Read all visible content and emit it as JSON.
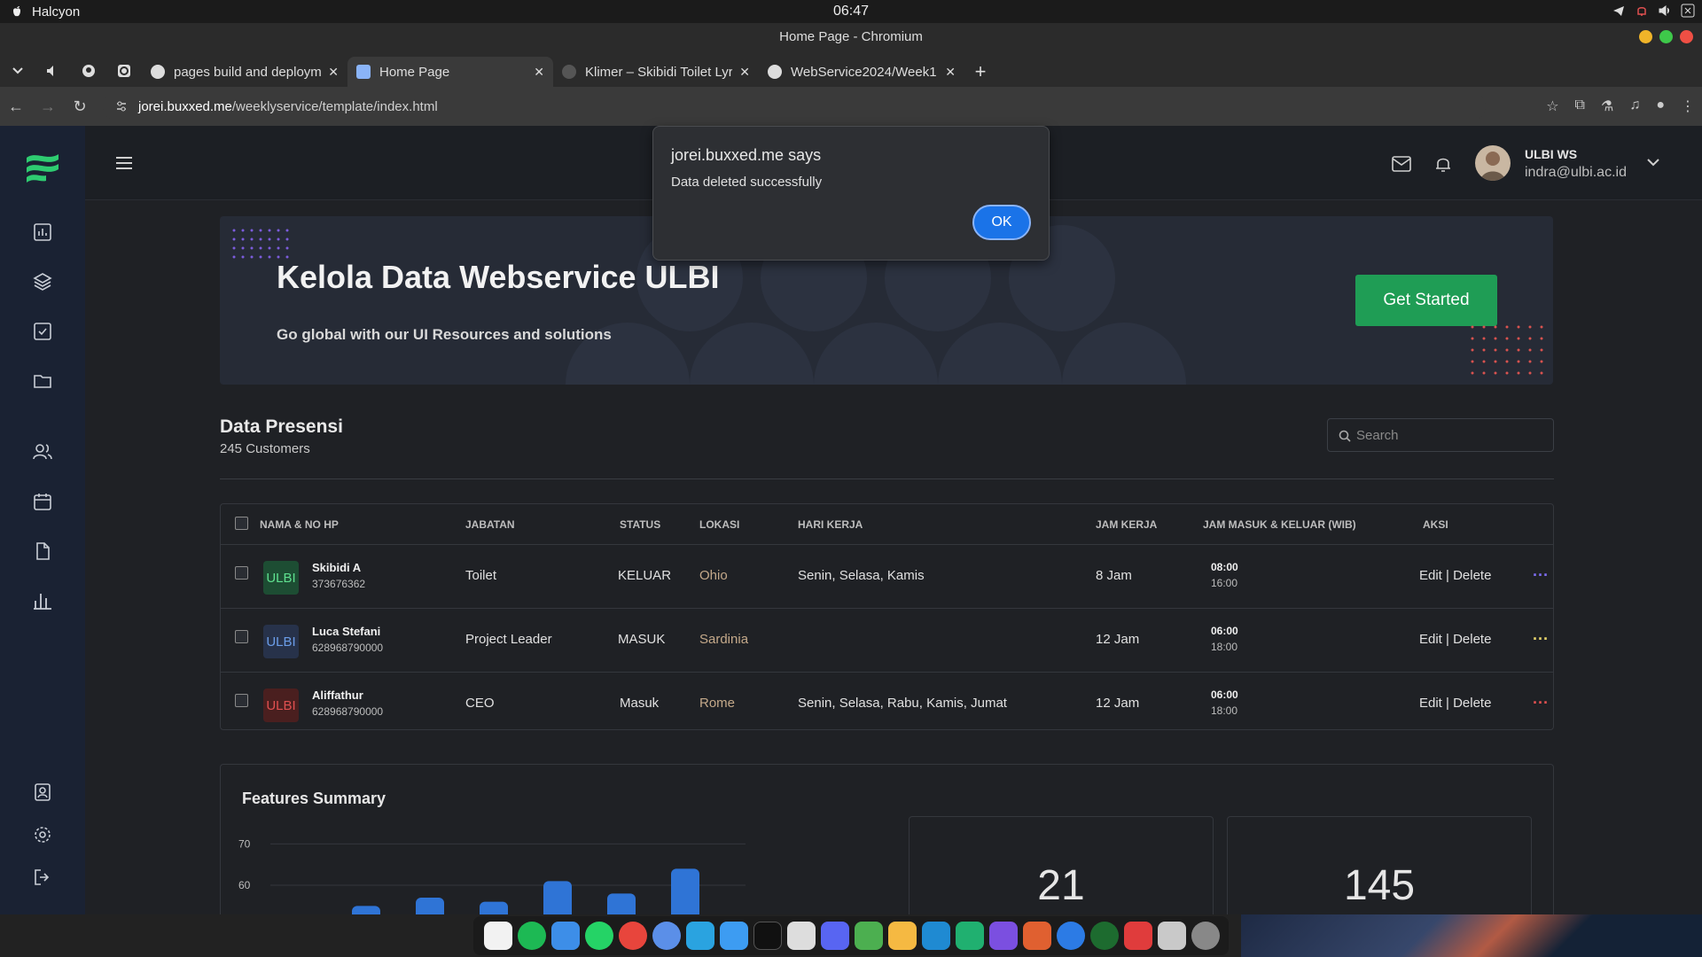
{
  "os": {
    "app_name": "Halcyon",
    "clock": "06:47"
  },
  "browser": {
    "window_title": "Home Page - Chromium",
    "tabs": [
      {
        "label": "pages build and deployme"
      },
      {
        "label": "Home Page"
      },
      {
        "label": "Klimer – Skibidi Toilet Lyr"
      },
      {
        "label": "WebService2024/Week1"
      }
    ],
    "url_host": "jorei.buxxed.me",
    "url_path": "/weeklyservice/template/index.html"
  },
  "user": {
    "name": "ULBI WS",
    "email": "indra@ulbi.ac.id"
  },
  "hero": {
    "title": "Kelola Data Webservice ULBI",
    "subtitle": "Go global with our UI Resources and solutions",
    "cta": "Get Started"
  },
  "section": {
    "title": "Data Presensi",
    "count": "245 Customers",
    "search_placeholder": "Search"
  },
  "table": {
    "headers": [
      "NAMA & NO HP",
      "JABATAN",
      "STATUS",
      "LOKASI",
      "HARI KERJA",
      "JAM KERJA",
      "JAM MASUK & KELUAR (WIB)",
      "AKSI"
    ],
    "rows": [
      {
        "badge": "ULBI",
        "name": "Skibidi A",
        "phone": "373676362",
        "jabatan": "Toilet",
        "status": "KELUAR",
        "lokasi": "Ohio",
        "hari": "Senin, Selasa, Kamis",
        "jam_kerja": "8 Jam",
        "masuk": "08:00",
        "keluar": "16:00",
        "aksi": "Edit | Delete"
      },
      {
        "badge": "ULBI",
        "name": "Luca Stefani",
        "phone": "628968790000",
        "jabatan": "Project Leader",
        "status": "MASUK",
        "lokasi": "Sardinia",
        "hari": "",
        "jam_kerja": "12 Jam",
        "masuk": "06:00",
        "keluar": "18:00",
        "aksi": "Edit | Delete"
      },
      {
        "badge": "ULBI",
        "name": "Aliffathur",
        "phone": "628968790000",
        "jabatan": "CEO",
        "status": "Masuk",
        "lokasi": "Rome",
        "hari": "Senin, Selasa, Rabu, Kamis, Jumat",
        "jam_kerja": "12 Jam",
        "masuk": "06:00",
        "keluar": "18:00",
        "aksi": "Edit | Delete"
      }
    ]
  },
  "features": {
    "title": "Features Summary",
    "card1": "21",
    "card2": "145"
  },
  "chart_data": {
    "type": "bar",
    "y_ticks": [
      "70",
      "60"
    ],
    "values": [
      55,
      57,
      56,
      61,
      58,
      64
    ],
    "ylim": [
      45,
      75
    ],
    "color": "#2f74d6"
  },
  "dialog": {
    "title": "jorei.buxxed.me says",
    "message": "Data deleted successfully",
    "ok": "OK"
  },
  "colors": {
    "accent": "#1f9d55",
    "link": "#1a73e8",
    "more": "#7c6cf0"
  }
}
